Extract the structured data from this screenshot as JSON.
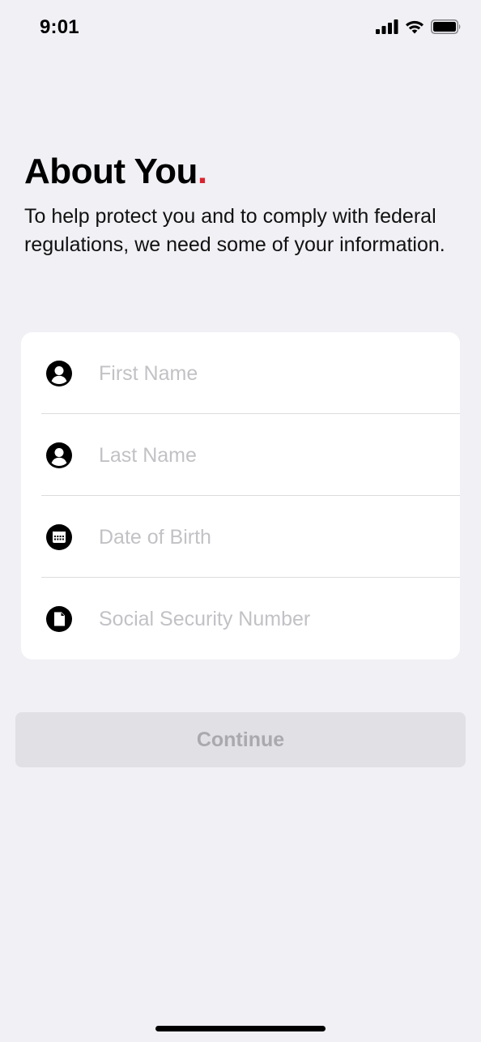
{
  "status_bar": {
    "time": "9:01",
    "icons": [
      "cellular-signal-icon",
      "wifi-icon",
      "battery-icon"
    ]
  },
  "header": {
    "title": "About You",
    "title_dot": ".",
    "subtitle": "To help protect you and to comply with federal regulations, we need some of your information."
  },
  "form": {
    "fields": [
      {
        "icon": "person-icon",
        "placeholder": "First Name",
        "value": ""
      },
      {
        "icon": "person-icon",
        "placeholder": "Last Name",
        "value": ""
      },
      {
        "icon": "calendar-icon",
        "placeholder": "Date of Birth",
        "value": ""
      },
      {
        "icon": "document-icon",
        "placeholder": "Social Security Number",
        "value": ""
      }
    ]
  },
  "actions": {
    "continue_label": "Continue",
    "continue_enabled": false
  },
  "colors": {
    "background": "#f0f0f5",
    "accent_dot": "#d9242f",
    "placeholder": "#c2c2c6",
    "button_disabled_bg": "#e0e0e5",
    "button_disabled_text": "#a9a9ae"
  }
}
